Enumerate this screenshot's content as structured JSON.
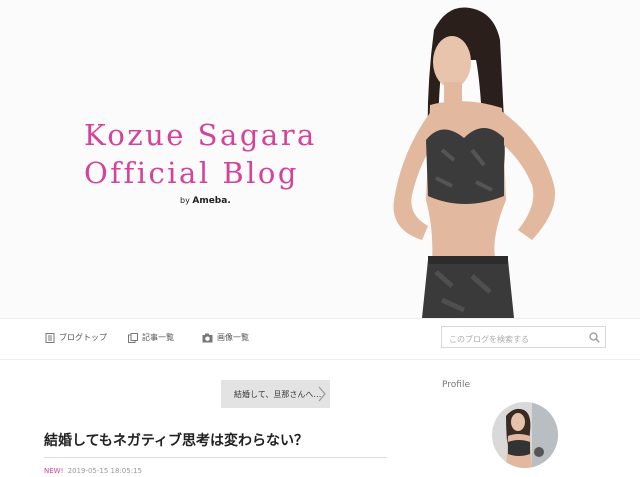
{
  "header": {
    "title_line1": "Kozue Sagara",
    "title_line2": "Official Blog",
    "byline_prefix": "by",
    "byline_brand": "Ameba.",
    "accent_color": "#d6419a"
  },
  "nav": {
    "items": [
      {
        "label": "ブログトップ",
        "icon": "document-icon"
      },
      {
        "label": "記事一覧",
        "icon": "list-icon"
      },
      {
        "label": "画像一覧",
        "icon": "camera-icon"
      }
    ],
    "search_placeholder": "このブログを検索する"
  },
  "post": {
    "prev_link": "結婚して、旦那さんへ…",
    "title": "結婚してもネガティブ思考は変わらない？",
    "badge": "NEW!",
    "date": "2019-05-15 18:05:15"
  },
  "sidebar": {
    "profile_heading": "Profile"
  }
}
